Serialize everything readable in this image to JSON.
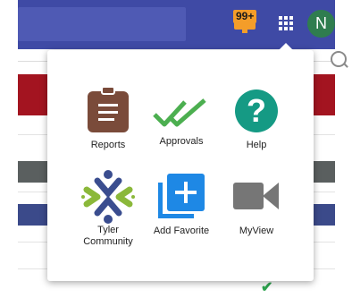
{
  "header": {
    "notification_count": "99+",
    "user_initial": "N"
  },
  "apps_menu": {
    "items": [
      {
        "label": "Reports",
        "icon": "clipboard-icon"
      },
      {
        "label": "Approvals",
        "icon": "double-check-icon"
      },
      {
        "label": "Help",
        "icon": "question-icon"
      },
      {
        "label": "Tyler Community",
        "icon": "tyler-community-icon"
      },
      {
        "label": "Add Favorite",
        "icon": "add-favorite-icon"
      },
      {
        "label": "MyView",
        "icon": "video-camera-icon"
      }
    ]
  },
  "colors": {
    "topbar": "#3f4aa5",
    "badge": "#f49d29",
    "avatar": "#2f7d4f",
    "reports": "#7a4b3a",
    "approvals": "#4caf50",
    "help": "#159a84",
    "favorite": "#1e88e5",
    "myview": "#767676"
  }
}
